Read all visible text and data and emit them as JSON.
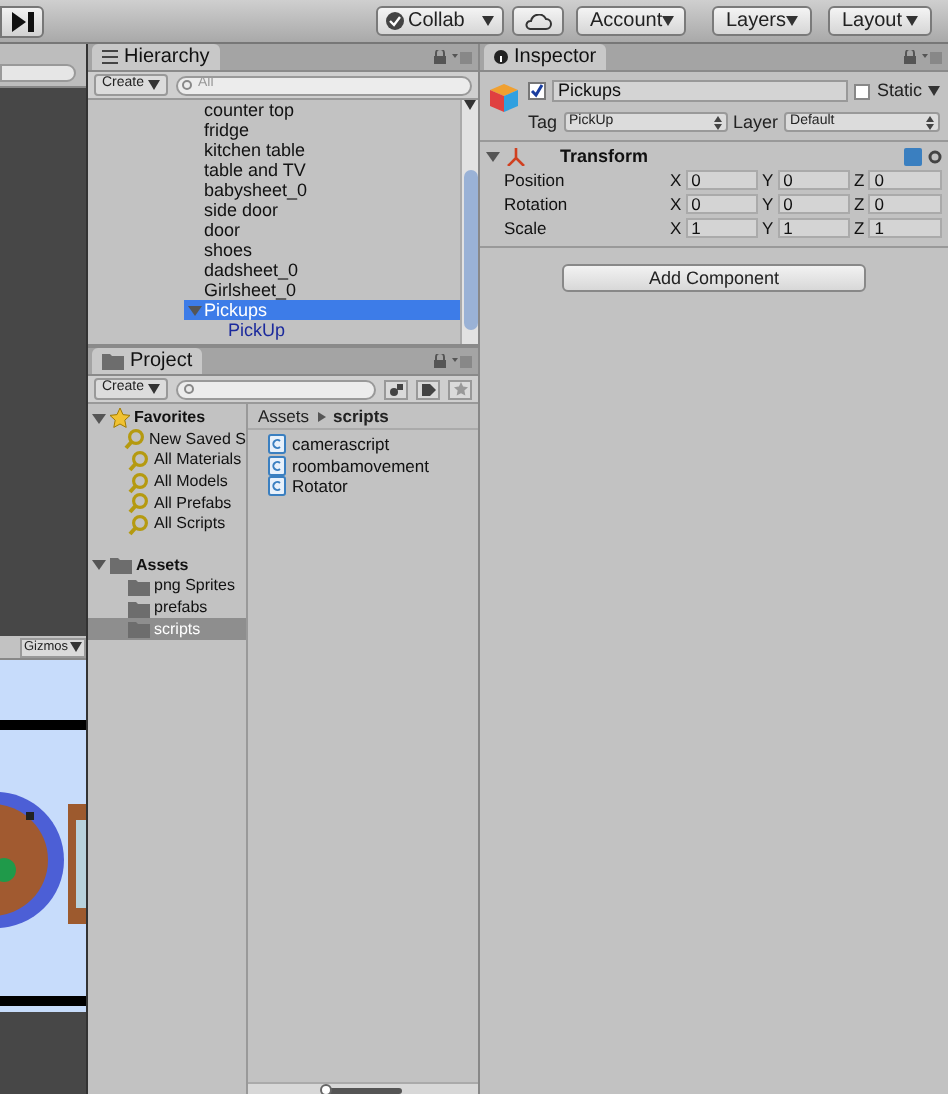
{
  "toolbar": {
    "collab": "Collab",
    "account": "Account",
    "layers": "Layers",
    "layout": "Layout"
  },
  "scene": {
    "gizmos": "Gizmos"
  },
  "hierarchy": {
    "title": "Hierarchy",
    "create": "Create",
    "search_placeholder": "All",
    "items": [
      {
        "label": "counter top",
        "selected": false
      },
      {
        "label": "fridge",
        "selected": false
      },
      {
        "label": "kitchen table",
        "selected": false
      },
      {
        "label": "table and TV",
        "selected": false
      },
      {
        "label": "babysheet_0",
        "selected": false
      },
      {
        "label": "side door",
        "selected": false
      },
      {
        "label": "door",
        "selected": false
      },
      {
        "label": "shoes",
        "selected": false
      },
      {
        "label": "dadsheet_0",
        "selected": false
      },
      {
        "label": "Girlsheet_0",
        "selected": false
      },
      {
        "label": "Pickups",
        "selected": true,
        "expanded": true,
        "children": [
          {
            "label": "PickUp",
            "selected": false,
            "kind": "prefab"
          }
        ]
      }
    ]
  },
  "project": {
    "title": "Project",
    "create": "Create",
    "tree": [
      {
        "label": "Favorites",
        "kind": "favorites",
        "expanded": true,
        "selected": false,
        "children": [
          {
            "label": "New Saved S",
            "kind": "search",
            "selected": false
          },
          {
            "label": "All Materials",
            "kind": "search",
            "selected": false
          },
          {
            "label": "All Models",
            "kind": "search",
            "selected": false
          },
          {
            "label": "All Prefabs",
            "kind": "search",
            "selected": false
          },
          {
            "label": "All Scripts",
            "kind": "search",
            "selected": false
          }
        ]
      },
      {
        "label": "Assets",
        "kind": "folder",
        "expanded": true,
        "selected": false,
        "children": [
          {
            "label": "png Sprites",
            "kind": "folder",
            "selected": false
          },
          {
            "label": "prefabs",
            "kind": "folder",
            "selected": false
          },
          {
            "label": "scripts",
            "kind": "folder",
            "selected": true
          }
        ]
      }
    ],
    "breadcrumb": [
      "Assets",
      "scripts"
    ],
    "files": [
      "camerascript",
      "roombamovement",
      "Rotator"
    ],
    "zoom_slider": {
      "level": 0
    }
  },
  "inspector": {
    "title": "Inspector",
    "object": {
      "name": "Pickups",
      "active": true,
      "static_label": "Static",
      "static": false,
      "tag_label": "Tag",
      "tag": "PickUp",
      "layer_label": "Layer",
      "layer": "Default"
    },
    "component": {
      "title": "Transform",
      "expanded": true,
      "rows": [
        {
          "label": "Position",
          "fields": [
            {
              "axis": "X",
              "value": "0"
            },
            {
              "axis": "Y",
              "value": "0"
            },
            {
              "axis": "Z",
              "value": "0"
            }
          ]
        },
        {
          "label": "Rotation",
          "fields": [
            {
              "axis": "X",
              "value": "0"
            },
            {
              "axis": "Y",
              "value": "0"
            },
            {
              "axis": "Z",
              "value": "0"
            }
          ]
        },
        {
          "label": "Scale",
          "fields": [
            {
              "axis": "X",
              "value": "1"
            },
            {
              "axis": "Y",
              "value": "1"
            },
            {
              "axis": "Z",
              "value": "1"
            }
          ]
        }
      ]
    },
    "add_component": "Add Component"
  }
}
